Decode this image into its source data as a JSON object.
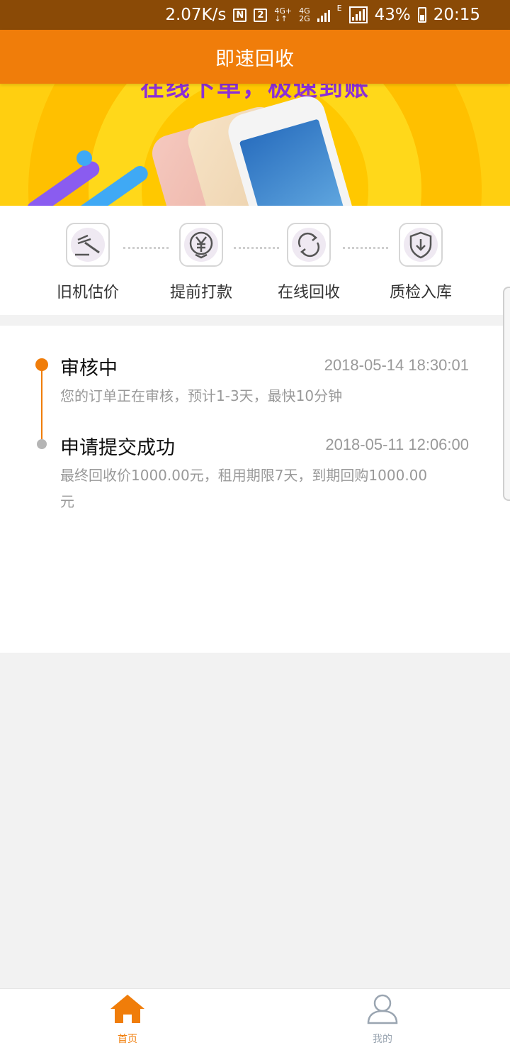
{
  "status_bar": {
    "speed": "2.07K/s",
    "nfc": "N",
    "sim": "2",
    "net_a_top": "4G+",
    "net_a_bottom": "↓↑",
    "net_b_top": "4G",
    "net_b_bottom": "2G",
    "net_c": "E",
    "battery": "43%",
    "time": "20:15"
  },
  "header": {
    "title": "即速回收"
  },
  "steps": [
    {
      "label": "旧机估价",
      "icon": "gavel-icon"
    },
    {
      "label": "提前打款",
      "icon": "yen-icon"
    },
    {
      "label": "在线回收",
      "icon": "refresh-icon"
    },
    {
      "label": "质检入库",
      "icon": "shield-download-icon"
    }
  ],
  "timeline": [
    {
      "title": "审核中",
      "time": "2018-05-14 18:30:01",
      "desc": "您的订单正在审核，预计1-3天，最快10分钟",
      "status_color": "#f07d0a"
    },
    {
      "title": "申请提交成功",
      "time": "2018-05-11 12:06:00",
      "desc": "最终回收价1000.00元，租用期限7天，到期回购1000.00元",
      "status_color": "#b5b5b5"
    }
  ],
  "bottom_nav": [
    {
      "label": "首页",
      "icon": "home-icon",
      "active": true
    },
    {
      "label": "我的",
      "icon": "user-icon",
      "active": false
    }
  ],
  "colors": {
    "accent": "#f07d0a",
    "status_bar": "#8a4a06",
    "inactive": "#9aa5b1"
  }
}
